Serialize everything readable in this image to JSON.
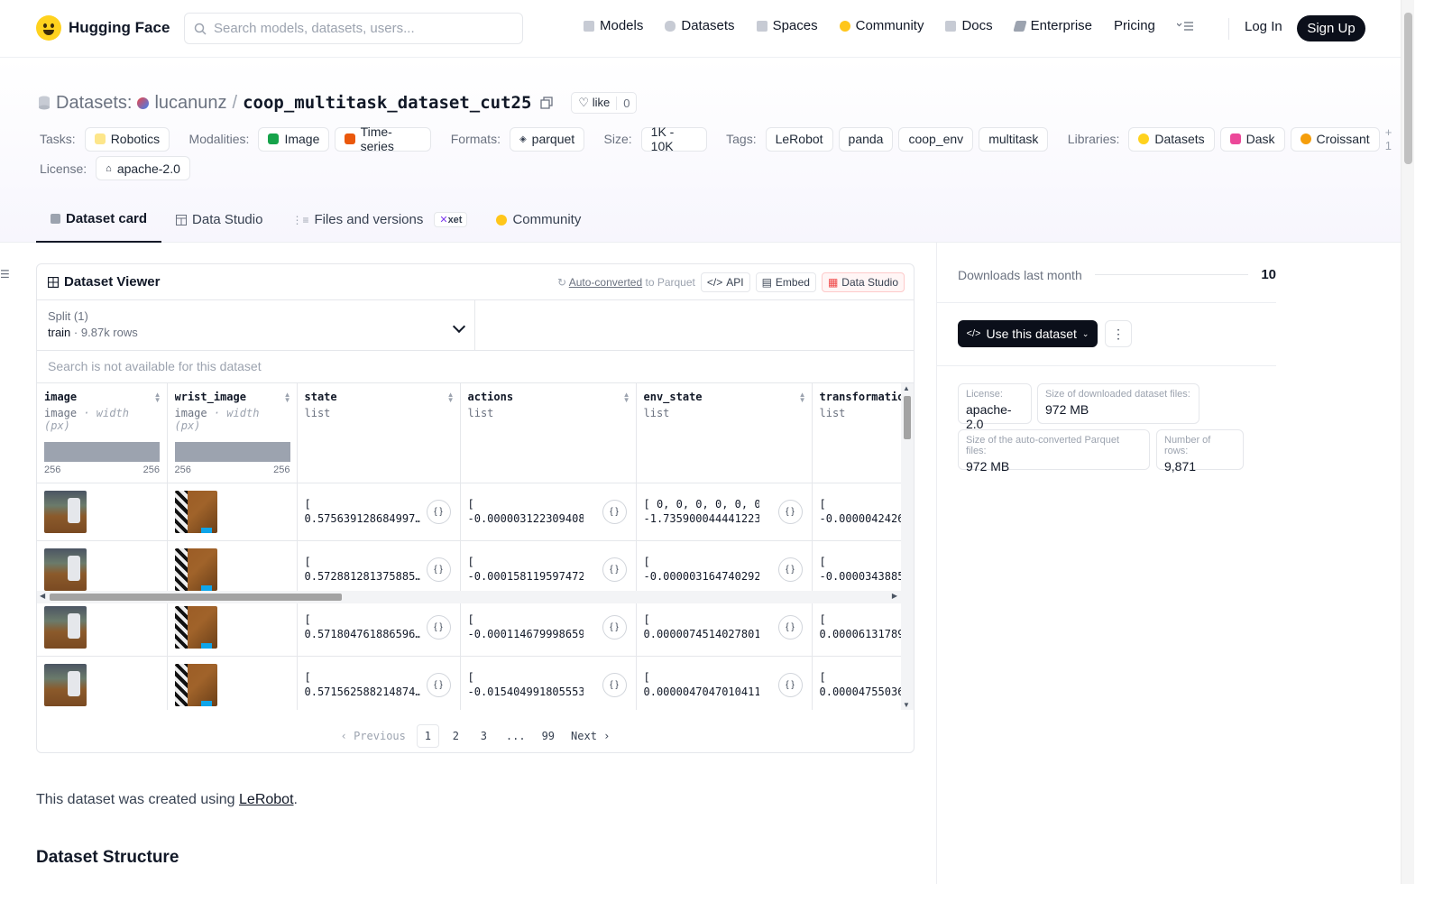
{
  "nav": {
    "brand": "Hugging Face",
    "search_placeholder": "Search models, datasets, users...",
    "links": [
      "Models",
      "Datasets",
      "Spaces",
      "Community",
      "Docs",
      "Enterprise",
      "Pricing"
    ],
    "login": "Log In",
    "signup": "Sign Up"
  },
  "header": {
    "section": "Datasets:",
    "owner": "lucanunz",
    "slash": "/",
    "repo": "coop_multitask_dataset_cut25",
    "like_label": "like",
    "like_count": "0",
    "tasks_label": "Tasks:",
    "task": "Robotics",
    "modalities_label": "Modalities:",
    "modalities": [
      "Image",
      "Time-series"
    ],
    "formats_label": "Formats:",
    "format": "parquet",
    "size_label": "Size:",
    "size": "1K - 10K",
    "tags_label": "Tags:",
    "tags": [
      "LeRobot",
      "panda",
      "coop_env",
      "multitask"
    ],
    "libraries_label": "Libraries:",
    "libraries": [
      "Datasets",
      "Dask",
      "Croissant"
    ],
    "libraries_more": "+ 1",
    "license_label": "License:",
    "license": "apache-2.0"
  },
  "tabs": {
    "card": "Dataset card",
    "studio": "Data Studio",
    "files": "Files and versions",
    "xet": "xet",
    "community": "Community"
  },
  "viewer": {
    "title": "Dataset Viewer",
    "auto_link": "Auto-converted",
    "auto_rest": "to Parquet",
    "api": "API",
    "embed": "Embed",
    "studio": "Data Studio",
    "split_label": "Split (1)",
    "split_name": "train",
    "split_dot": "·",
    "split_rows": "9.87k rows",
    "search_na": "Search is not available for this dataset",
    "columns": [
      {
        "name": "image",
        "type": "image",
        "sub": "· width (px)",
        "min": "256",
        "max": "256"
      },
      {
        "name": "wrist_image",
        "type": "image",
        "sub": "· width (px)",
        "min": "256",
        "max": "256"
      },
      {
        "name": "state",
        "type": "list"
      },
      {
        "name": "actions",
        "type": "list"
      },
      {
        "name": "env_state",
        "type": "list"
      },
      {
        "name": "transformatio",
        "type": "list"
      }
    ],
    "rows": [
      {
        "state": "[\n0.575639128684997…",
        "actions": "[\n-0.0000031223094083…",
        "env_state": "[ 0, 0, 0, 0, 0, 0,\n-1.7359000444412231…",
        "transformation": "[\n-0.0000042426"
      },
      {
        "state": "[\n0.572881281375885…",
        "actions": "[\n-0.0001581195974722…",
        "env_state": "[\n-0.0000031647402920…",
        "transformation": "[\n-0.0000343885"
      },
      {
        "state": "[\n0.571804761886596…",
        "actions": "[\n-0.0001146799986599…",
        "env_state": "[\n0.00000745140278013…",
        "transformation": "[\n0.00006131789"
      },
      {
        "state": "[\n0.571562588214874…",
        "actions": "[\n-0.0154049918055534…",
        "env_state": "[\n0.00000470470104119…",
        "transformation": "[\n0.00004755036"
      }
    ],
    "expand_glyph": "{ }",
    "pager": {
      "prev": "Previous",
      "pages": [
        "1",
        "2",
        "3",
        "...",
        "99"
      ],
      "next": "Next"
    }
  },
  "card": {
    "intro_before": "This dataset was created using ",
    "intro_link": "LeRobot",
    "intro_after": ".",
    "section_title": "Dataset Structure"
  },
  "sidebar": {
    "downloads_label": "Downloads last month",
    "downloads": "10",
    "use_button": "Use this dataset",
    "stats": [
      {
        "label": "License:",
        "value": "apache-2.0"
      },
      {
        "label": "Size of downloaded dataset files:",
        "value": "972 MB"
      },
      {
        "label": "Size of the auto-converted Parquet files:",
        "value": "972 MB"
      },
      {
        "label": "Number of rows:",
        "value": "9,871"
      }
    ]
  }
}
